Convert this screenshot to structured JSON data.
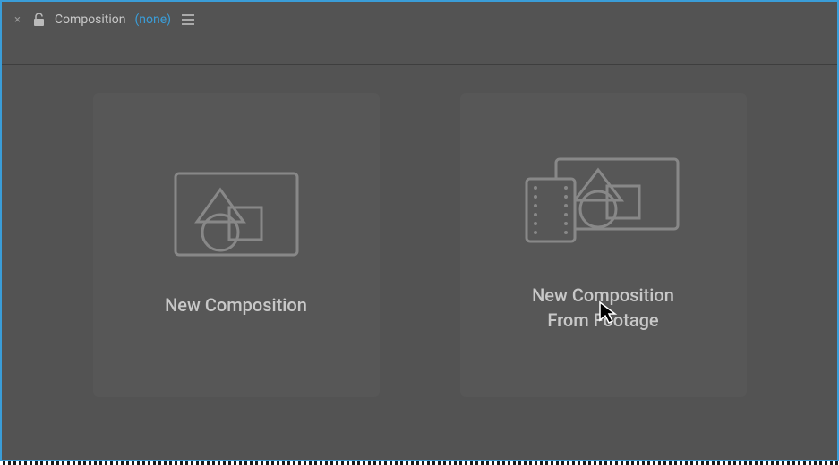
{
  "tab": {
    "title": "Composition",
    "active_name": "(none)"
  },
  "cards": {
    "new_comp": "New Composition",
    "new_comp_footage_line1": "New Composition",
    "new_comp_footage_line2": "From Footage"
  }
}
